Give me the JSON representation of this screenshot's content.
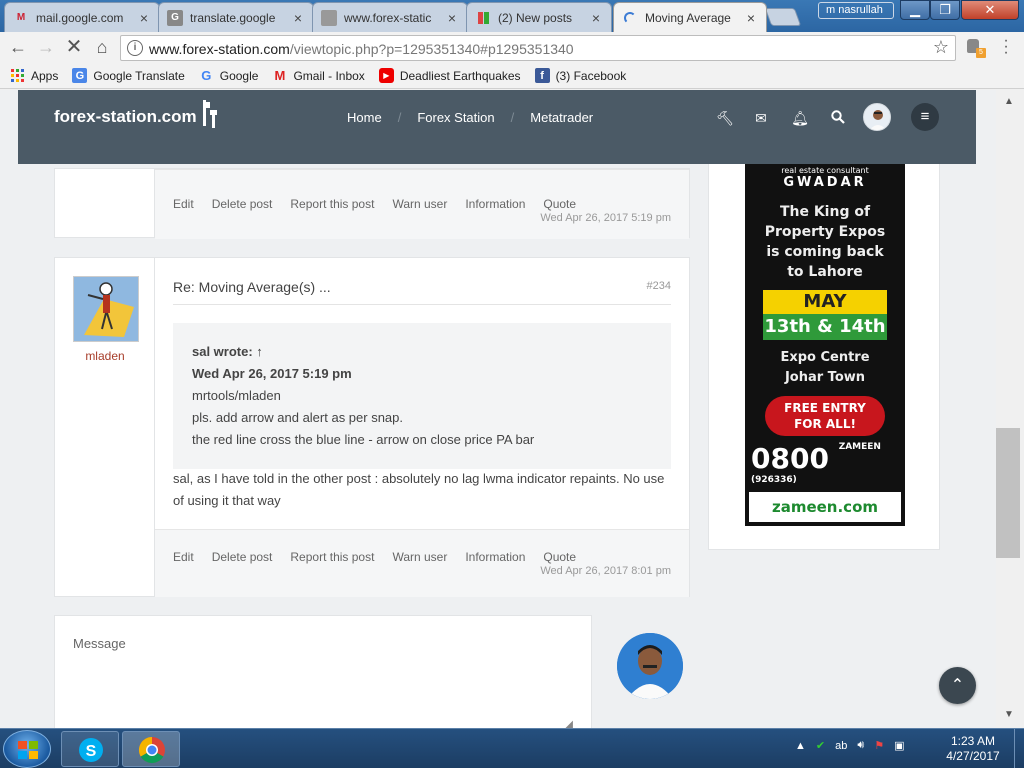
{
  "browser": {
    "tabs": [
      {
        "title": "mail.google.com",
        "icon": "gmail-icon"
      },
      {
        "title": "translate.google",
        "icon": "translate-icon"
      },
      {
        "title": "www.forex-static",
        "icon": "page-icon"
      },
      {
        "title": "(2) New posts",
        "icon": "forum-icon"
      },
      {
        "title": "Moving Average",
        "icon": "loading-spinner-icon",
        "active": true
      }
    ],
    "profile_name": "m nasrullah",
    "url_host": "www.forex-station.com",
    "url_path": "/viewtopic.php?p=1295351340#p1295351340",
    "bookmarks": [
      {
        "label": "Apps",
        "icon": "apps-icon"
      },
      {
        "label": "Google Translate",
        "icon": "google-translate-icon"
      },
      {
        "label": "Google",
        "icon": "google-icon"
      },
      {
        "label": "Gmail - Inbox",
        "icon": "gmail-icon"
      },
      {
        "label": "Deadliest Earthquakes",
        "icon": "youtube-icon"
      },
      {
        "label": "(3) Facebook",
        "icon": "facebook-icon"
      }
    ]
  },
  "site": {
    "logo": "forex-station.com",
    "nav": [
      "Home",
      "Forex Station",
      "Metatrader"
    ],
    "header_icons": [
      "gavel-icon",
      "envelope-icon",
      "bell-icon",
      "search-icon"
    ],
    "colors": {
      "header": "#4b5a66",
      "author": "#a73d2a"
    }
  },
  "posts": [
    {
      "actions": [
        "Edit",
        "Delete post",
        "Report this post",
        "Warn user",
        "Information",
        "Quote"
      ],
      "date": "Wed Apr 26, 2017 5:19 pm"
    },
    {
      "author": "mladen",
      "title": "Re: Moving Average(s) ...",
      "number": "#234",
      "quote": {
        "author_line": "sal wrote: ↑",
        "date_line": "Wed Apr 26, 2017 5:19 pm",
        "lines": [
          "mrtools/mladen",
          "pls. add arrow and alert as per snap.",
          "the red line cross the blue line - arrow on close price PA bar"
        ]
      },
      "body": "sal, as I have told in the other post : absolutely no lag lwma indicator repaints. No use of using it that way",
      "actions": [
        "Edit",
        "Delete post",
        "Report this post",
        "Warn user",
        "Information",
        "Quote"
      ],
      "date": "Wed Apr 26, 2017 8:01 pm"
    }
  ],
  "reply": {
    "placeholder": "Message"
  },
  "ad": {
    "line1": "real estate consultant",
    "line2": "GWADAR",
    "headline": [
      "The King of",
      "Property Expos",
      "is coming back",
      "to Lahore"
    ],
    "month": "MAY",
    "dates": "13th & 14th",
    "venue": [
      "Expo Centre",
      "Johar Town"
    ],
    "offer": [
      "FREE ENTRY",
      "FOR ALL!"
    ],
    "phone": "0800",
    "phone_suffix": "ZAMEEN (926336)",
    "brand": "zameen.com"
  },
  "taskbar": {
    "apps": [
      "skype-icon",
      "chrome-icon"
    ],
    "time": "1:23 AM",
    "date": "4/27/2017"
  }
}
